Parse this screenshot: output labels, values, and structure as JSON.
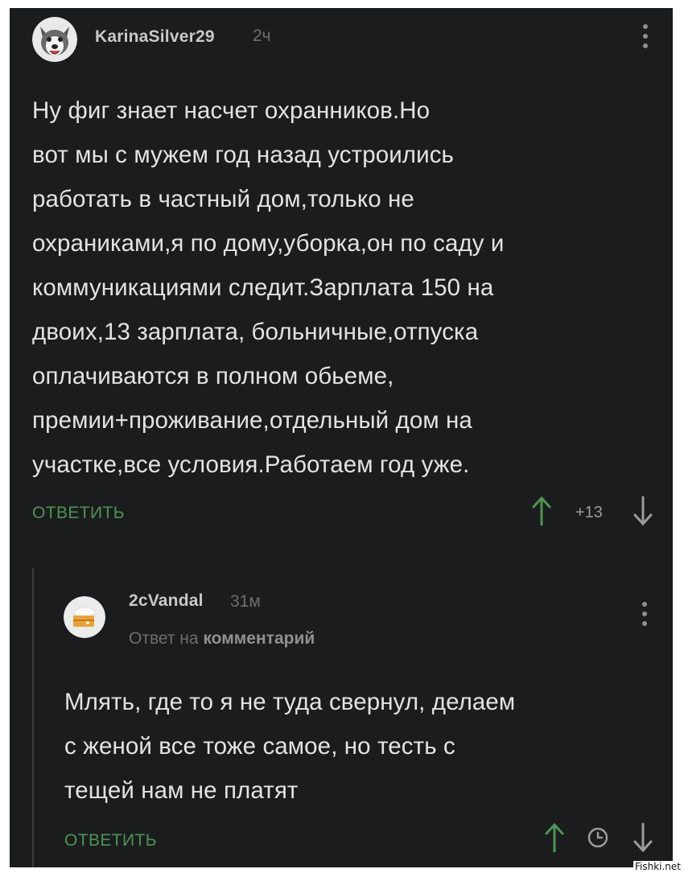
{
  "comment": {
    "username": "KarinaSilver29",
    "time": "2ч",
    "avatar_icon": "husky-dog-avatar-icon",
    "text": "Ну фиг знает насчет охранников.Но\nвот мы с мужем год назад устроились\nработать в частный дом,только не\nохраниками,я по дому,уборка,он по саду и\nкоммуникациями следит.Зарплата 150 на\nдвоих,13 зарплата, больничные,отпуска\nоплачиваются в полном обьеме,\nпремии+проживание,отдельный дом на\nучастке,все условия.Работаем год уже.",
    "reply_label": "ОТВЕТИТЬ",
    "score": "+13",
    "upvote_icon": "upvote-arrow-icon",
    "downvote_icon": "downvote-arrow-icon"
  },
  "reply": {
    "username": "2cVandal",
    "time": "31м",
    "avatar_icon": "cake-avatar-icon",
    "reply_to_prefix": "Ответ на",
    "reply_to_link": "комментарий",
    "text": "Млять, где то я не туда свернул, делаем\nс женой все тоже самое, но тесть с\nтещей нам не платят",
    "reply_label": "ОТВЕТИТЬ",
    "upvote_icon": "upvote-arrow-icon",
    "clock_icon": "clock-icon",
    "downvote_icon": "downvote-arrow-icon"
  },
  "watermark": "Fishki.net",
  "colors": {
    "background": "#1b1c1e",
    "text": "#e2e3e4",
    "accent_green": "#4f9452",
    "muted": "#6c6e70"
  }
}
